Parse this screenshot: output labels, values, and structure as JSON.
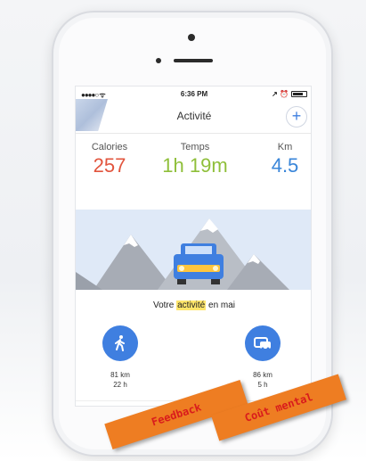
{
  "status_bar": {
    "signal": "●●●●○ ᯤ",
    "time": "6:36 PM",
    "indicators": "↗ ⏰"
  },
  "header": {
    "title": "Activité",
    "add_label": "+"
  },
  "stats": [
    {
      "label": "Calories",
      "value": "257"
    },
    {
      "label": "Temps",
      "value": "1h 19m"
    },
    {
      "label": "Km",
      "value": "4.5"
    }
  ],
  "month_summary": {
    "prefix": "Votre ",
    "highlight": "activité",
    "suffix": " en mai"
  },
  "activities": [
    {
      "icon": "walking-person-icon",
      "distance": "81 km",
      "duration": "22 h"
    },
    {
      "icon": "car-icon",
      "distance": "86 km",
      "duration": "5 h"
    }
  ],
  "stickers": {
    "feedback": "Feedback",
    "cout_mental": "Coût mental"
  },
  "colors": {
    "calories": "#e2553e",
    "temps": "#8fbf3a",
    "km": "#3a86d9",
    "accent_blue": "#3f7fe0",
    "sticker": "#ee7d22",
    "sticker_text": "#d91c1c",
    "highlight": "#ffe66b"
  }
}
